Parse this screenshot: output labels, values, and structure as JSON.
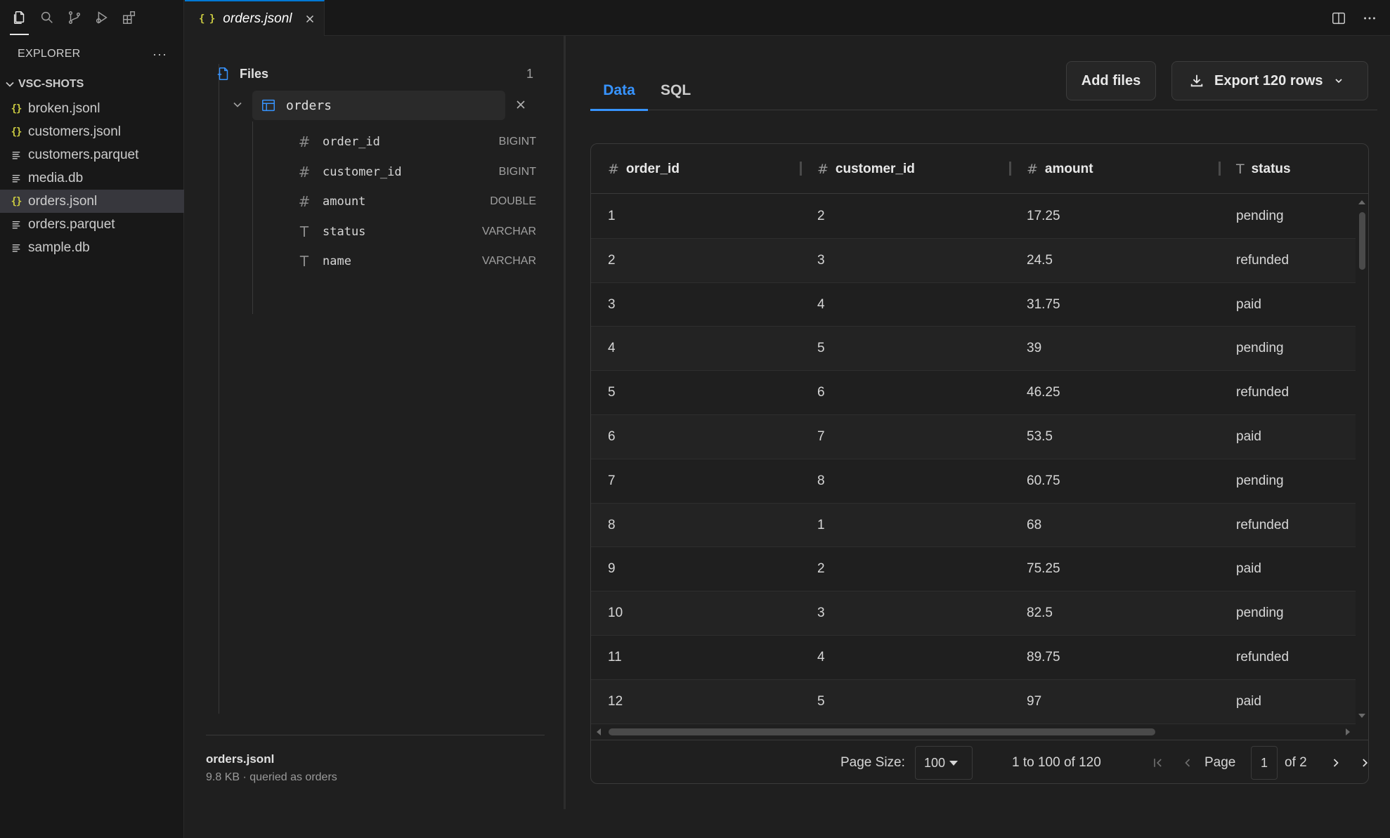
{
  "activity_bar": {
    "icons": [
      "files-icon",
      "search-icon",
      "source-control-icon",
      "run-debug-icon",
      "extensions-icon"
    ]
  },
  "explorer": {
    "title": "EXPLORER",
    "more": "···",
    "workspace": "VSC-SHOTS",
    "files": [
      {
        "name": "broken.jsonl",
        "icon": "json-icon"
      },
      {
        "name": "customers.jsonl",
        "icon": "json-icon"
      },
      {
        "name": "customers.parquet",
        "icon": "lines-icon"
      },
      {
        "name": "media.db",
        "icon": "lines-icon"
      },
      {
        "name": "orders.jsonl",
        "icon": "json-icon",
        "selected": true
      },
      {
        "name": "orders.parquet",
        "icon": "lines-icon"
      },
      {
        "name": "sample.db",
        "icon": "lines-icon"
      }
    ]
  },
  "editor": {
    "tab_title": "orders.jsonl",
    "tab_icon_glyph": "{ }"
  },
  "schema": {
    "files_label": "Files",
    "files_count": "1",
    "table_name": "orders",
    "columns": [
      {
        "name": "order_id",
        "type": "BIGINT",
        "icon": "#"
      },
      {
        "name": "customer_id",
        "type": "BIGINT",
        "icon": "#"
      },
      {
        "name": "amount",
        "type": "DOUBLE",
        "icon": "#"
      },
      {
        "name": "status",
        "type": "VARCHAR",
        "icon": "T"
      },
      {
        "name": "name",
        "type": "VARCHAR",
        "icon": "T"
      }
    ],
    "file_info": {
      "name": "orders.jsonl",
      "meta": "9.8 KB · queried as orders"
    }
  },
  "data_view": {
    "tabs": [
      "Data",
      "SQL"
    ],
    "active_tab": "Data",
    "add_files_label": "Add files",
    "export_label": "Export 120 rows",
    "columns": [
      {
        "label": "order_id",
        "icon": "#"
      },
      {
        "label": "customer_id",
        "icon": "#"
      },
      {
        "label": "amount",
        "icon": "#"
      },
      {
        "label": "status",
        "icon": "T"
      }
    ],
    "rows": [
      [
        "1",
        "2",
        "17.25",
        "pending"
      ],
      [
        "2",
        "3",
        "24.5",
        "refunded"
      ],
      [
        "3",
        "4",
        "31.75",
        "paid"
      ],
      [
        "4",
        "5",
        "39",
        "pending"
      ],
      [
        "5",
        "6",
        "46.25",
        "refunded"
      ],
      [
        "6",
        "7",
        "53.5",
        "paid"
      ],
      [
        "7",
        "8",
        "60.75",
        "pending"
      ],
      [
        "8",
        "1",
        "68",
        "refunded"
      ],
      [
        "9",
        "2",
        "75.25",
        "paid"
      ],
      [
        "10",
        "3",
        "82.5",
        "pending"
      ],
      [
        "11",
        "4",
        "89.75",
        "refunded"
      ],
      [
        "12",
        "5",
        "97",
        "paid"
      ]
    ],
    "footer": {
      "page_size_label": "Page Size:",
      "page_size_value": "100",
      "range_text": "1 to 100 of 120",
      "page_label": "Page",
      "page_value": "1",
      "page_total": "of 2"
    }
  },
  "colors": {
    "accent": "#3794ff",
    "json_icon": "#cbcb41",
    "background": "#1f1f1f",
    "sidebar": "#181818"
  }
}
